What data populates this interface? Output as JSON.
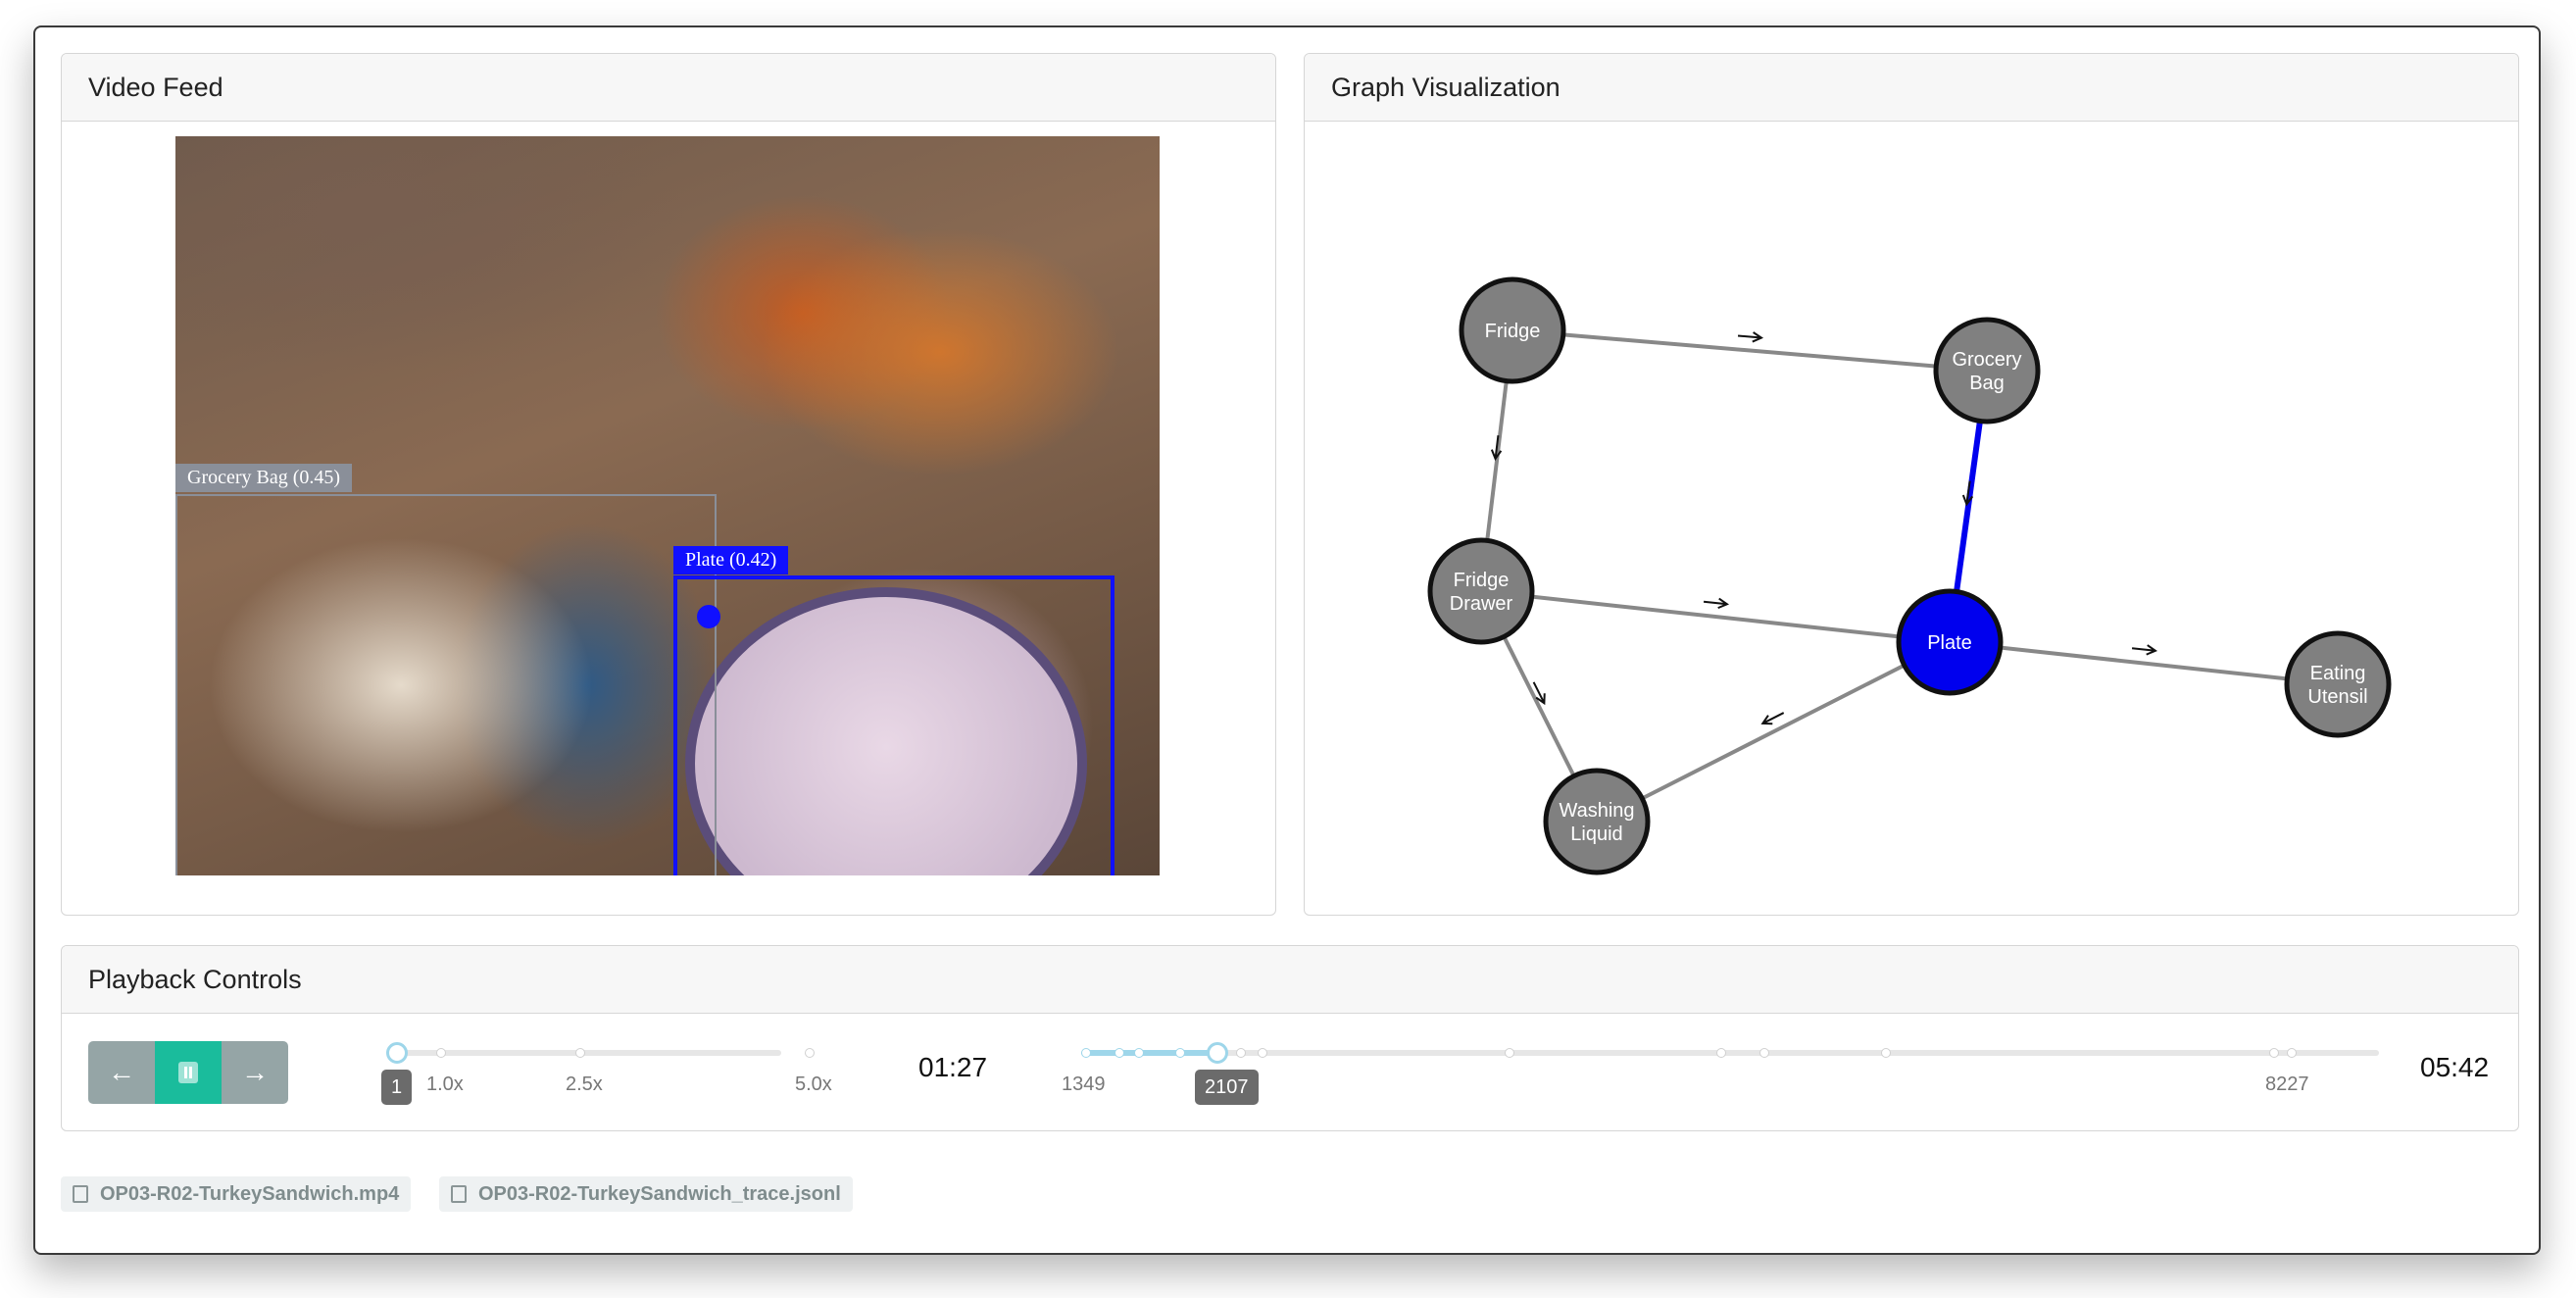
{
  "panels": {
    "video_title": "Video Feed",
    "graph_title": "Graph Visualization",
    "controls_title": "Playback Controls"
  },
  "video": {
    "detections": [
      {
        "label": "Grocery Bag (0.45)",
        "color": "#8a8f99"
      },
      {
        "label": "Plate (0.42)",
        "color": "#1010ff"
      }
    ]
  },
  "graph": {
    "nodes": [
      {
        "id": "fridge",
        "label": [
          "Fridge"
        ],
        "highlight": false
      },
      {
        "id": "grocery-bag",
        "label": [
          "Grocery",
          "Bag"
        ],
        "highlight": false
      },
      {
        "id": "fridge-drawer",
        "label": [
          "Fridge",
          "Drawer"
        ],
        "highlight": false
      },
      {
        "id": "plate",
        "label": [
          "Plate"
        ],
        "highlight": true
      },
      {
        "id": "eating-utensil",
        "label": [
          "Eating",
          "Utensil"
        ],
        "highlight": false
      },
      {
        "id": "washing-liquid",
        "label": [
          "Washing",
          "Liquid"
        ],
        "highlight": false
      }
    ],
    "edges": [
      {
        "from": "fridge",
        "to": "grocery-bag",
        "highlight": false
      },
      {
        "from": "fridge",
        "to": "fridge-drawer",
        "highlight": false
      },
      {
        "from": "grocery-bag",
        "to": "plate",
        "highlight": true
      },
      {
        "from": "fridge-drawer",
        "to": "plate",
        "highlight": false
      },
      {
        "from": "fridge-drawer",
        "to": "washing-liquid",
        "highlight": false
      },
      {
        "from": "plate",
        "to": "washing-liquid",
        "highlight": false
      },
      {
        "from": "plate",
        "to": "eating-utensil",
        "highlight": false
      }
    ],
    "colors": {
      "node": "#808080",
      "highlight": "#0000ee",
      "edge": "#888888"
    }
  },
  "controls": {
    "speed": {
      "value_badge": "1",
      "ticks": [
        "1.0x",
        "2.5x",
        "5.0x"
      ]
    },
    "current_time": "01:27",
    "frame": {
      "start_label": "1349",
      "current_badge": "2107",
      "end_label": "8227"
    },
    "total_time": "05:42",
    "buttons": {
      "prev": "←",
      "next": "→"
    }
  },
  "files": [
    {
      "name": "OP03-R02-TurkeySandwich.mp4",
      "icon": "film-icon"
    },
    {
      "name": "OP03-R02-TurkeySandwich_trace.jsonl",
      "icon": "file-code-icon"
    }
  ]
}
